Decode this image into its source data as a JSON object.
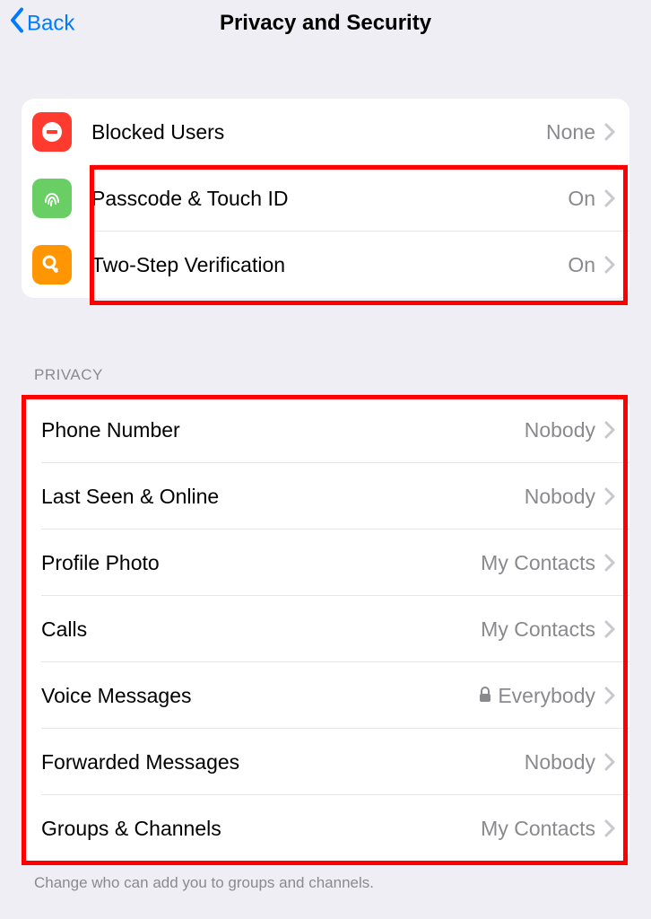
{
  "nav": {
    "back": "Back",
    "title": "Privacy and Security"
  },
  "security": {
    "blocked": {
      "label": "Blocked Users",
      "value": "None"
    },
    "passcode": {
      "label": "Passcode & Touch ID",
      "value": "On"
    },
    "twostep": {
      "label": "Two-Step Verification",
      "value": "On"
    }
  },
  "privacy": {
    "header": "PRIVACY",
    "phone": {
      "label": "Phone Number",
      "value": "Nobody"
    },
    "lastseen": {
      "label": "Last Seen & Online",
      "value": "Nobody"
    },
    "photo": {
      "label": "Profile Photo",
      "value": "My Contacts"
    },
    "calls": {
      "label": "Calls",
      "value": "My Contacts"
    },
    "voice": {
      "label": "Voice Messages",
      "value": "Everybody",
      "locked": true
    },
    "forwarded": {
      "label": "Forwarded Messages",
      "value": "Nobody"
    },
    "groups": {
      "label": "Groups & Channels",
      "value": "My Contacts"
    },
    "footer": "Change who can add you to groups and channels."
  }
}
